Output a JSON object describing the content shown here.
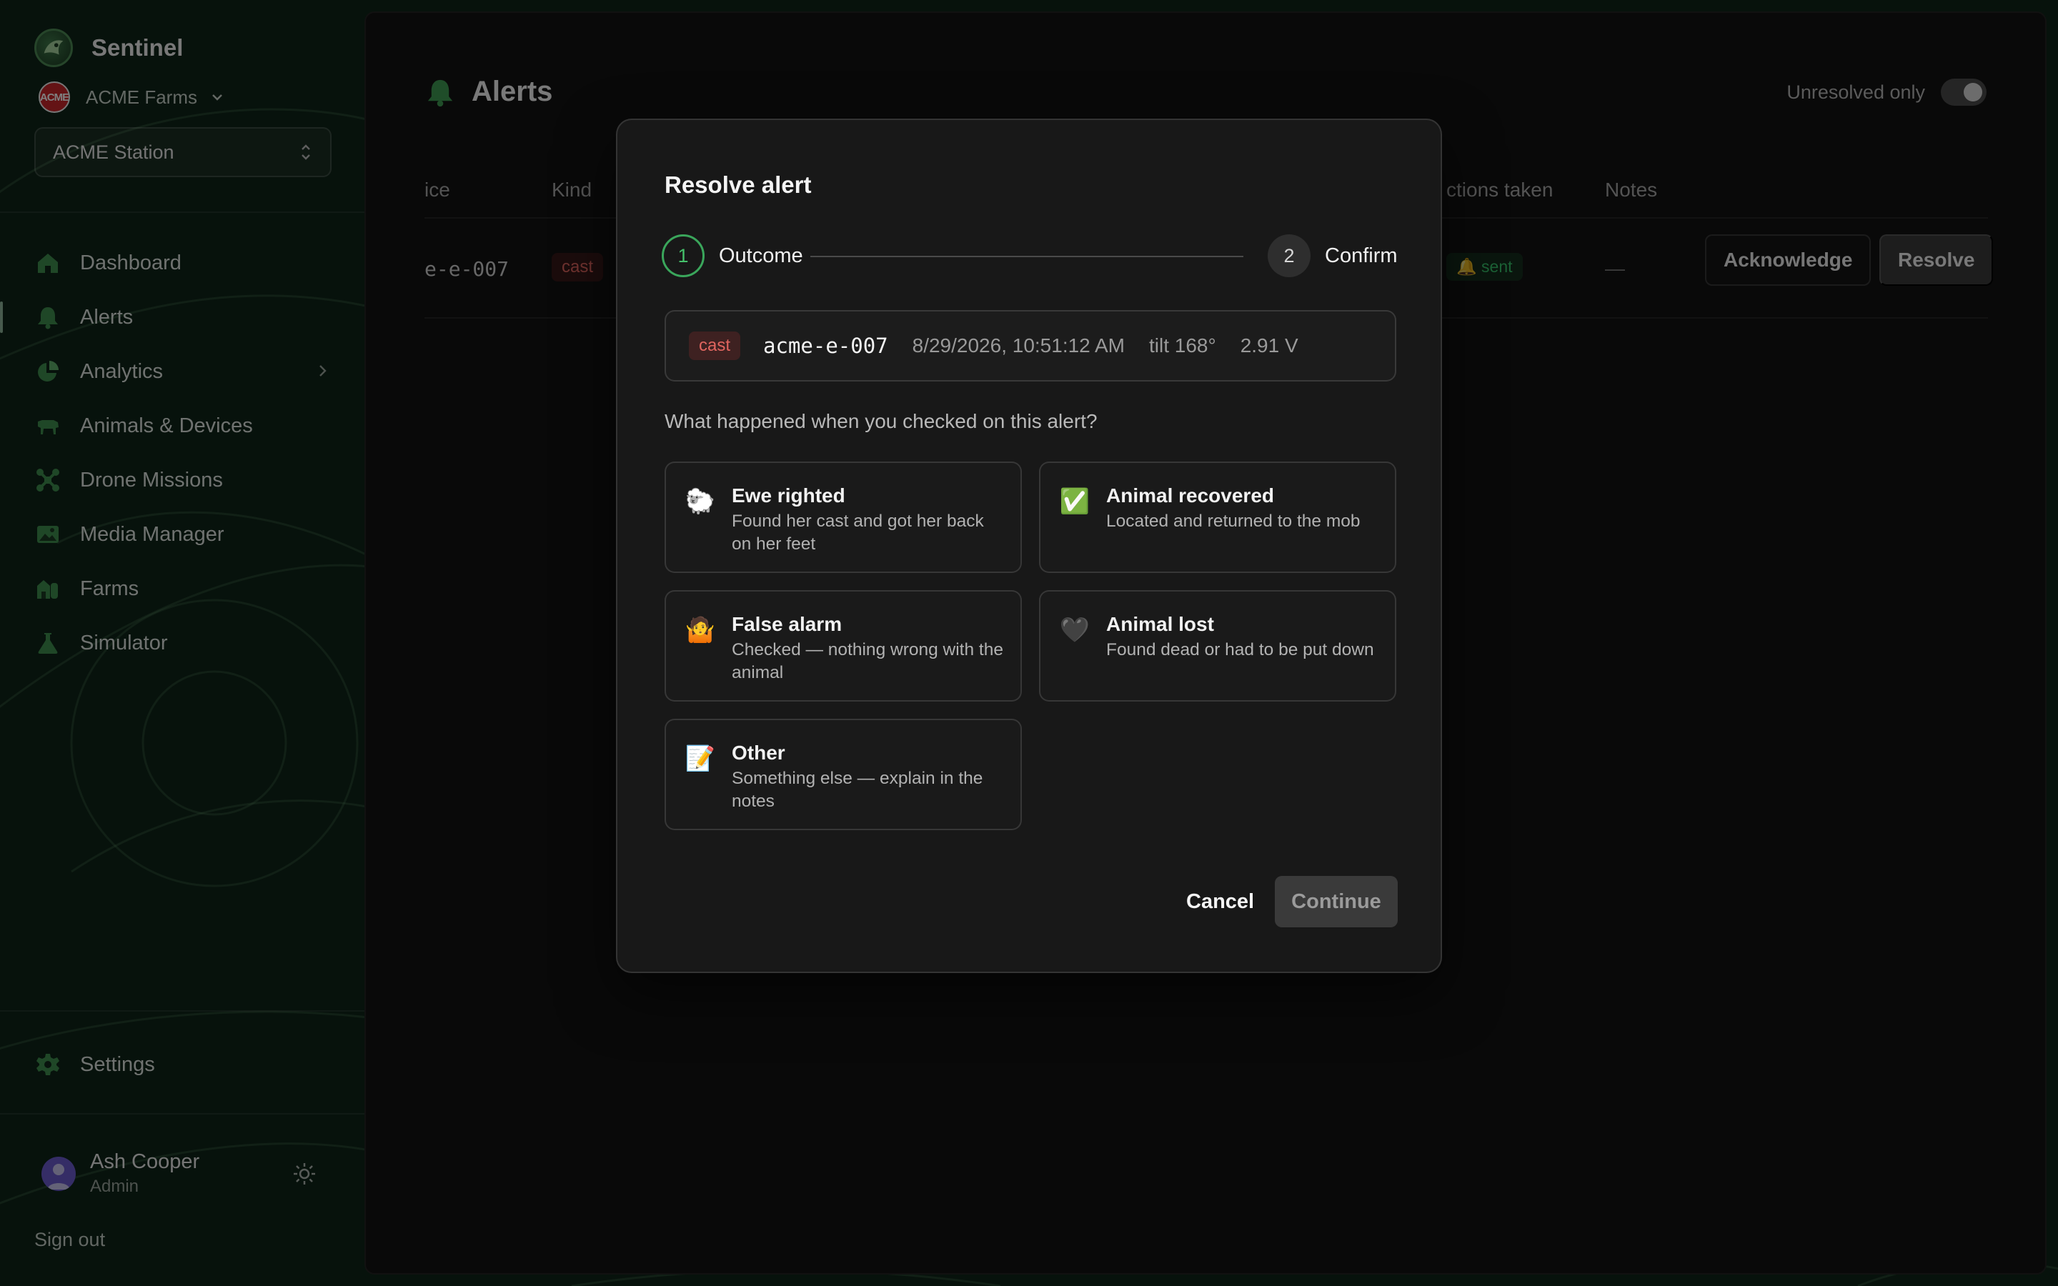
{
  "brand": {
    "name": "Sentinel"
  },
  "org": {
    "logo_text": "ACME",
    "name": "ACME Farms"
  },
  "station": {
    "selected": "ACME Station"
  },
  "nav": {
    "items": [
      {
        "label": "Dashboard",
        "icon": "home-icon"
      },
      {
        "label": "Alerts",
        "icon": "bell-icon",
        "active": true
      },
      {
        "label": "Analytics",
        "icon": "pie-chart-icon",
        "has_submenu": true
      },
      {
        "label": "Animals & Devices",
        "icon": "cow-icon"
      },
      {
        "label": "Drone Missions",
        "icon": "drone-icon"
      },
      {
        "label": "Media Manager",
        "icon": "image-icon"
      },
      {
        "label": "Farms",
        "icon": "barn-icon"
      },
      {
        "label": "Simulator",
        "icon": "flask-icon"
      }
    ],
    "settings_label": "Settings"
  },
  "user": {
    "name": "Ash Cooper",
    "role": "Admin"
  },
  "sign_out": "Sign out",
  "main": {
    "title": "Alerts",
    "unresolved_label": "Unresolved only",
    "table": {
      "headers": {
        "device": "ice",
        "kind": "Kind",
        "actions": "ctions taken",
        "notes": "Notes"
      },
      "rows": [
        {
          "device": "e-e-007",
          "kind": "cast",
          "actions": "sent",
          "notes": "—",
          "acknowledge": "Acknowledge",
          "resolve": "Resolve"
        }
      ]
    }
  },
  "modal": {
    "title": "Resolve alert",
    "steps": [
      {
        "number": "1",
        "label": "Outcome"
      },
      {
        "number": "2",
        "label": "Confirm"
      }
    ],
    "summary": {
      "kind": "cast",
      "device": "acme-e-007",
      "timestamp": "8/29/2026, 10:51:12 AM",
      "tilt": "tilt 168°",
      "voltage": "2.91 V"
    },
    "question": "What happened when you checked on this alert?",
    "options": [
      {
        "emoji": "🐑",
        "title": "Ewe righted",
        "desc": "Found her cast and got her back on her feet"
      },
      {
        "emoji": "✅",
        "title": "Animal recovered",
        "desc": "Located and returned to the mob"
      },
      {
        "emoji": "🤷",
        "title": "False alarm",
        "desc": "Checked — nothing wrong with the animal"
      },
      {
        "emoji": "🖤",
        "title": "Animal lost",
        "desc": "Found dead or had to be put down"
      },
      {
        "emoji": "📝",
        "title": "Other",
        "desc": "Something else — explain in the notes"
      }
    ],
    "cancel_label": "Cancel",
    "continue_label": "Continue"
  },
  "colors": {
    "accent_green": "#3aa65b",
    "cast_red": "#e0655f",
    "sent_green": "#37c26a",
    "sidebar_bg": "#10261a"
  }
}
